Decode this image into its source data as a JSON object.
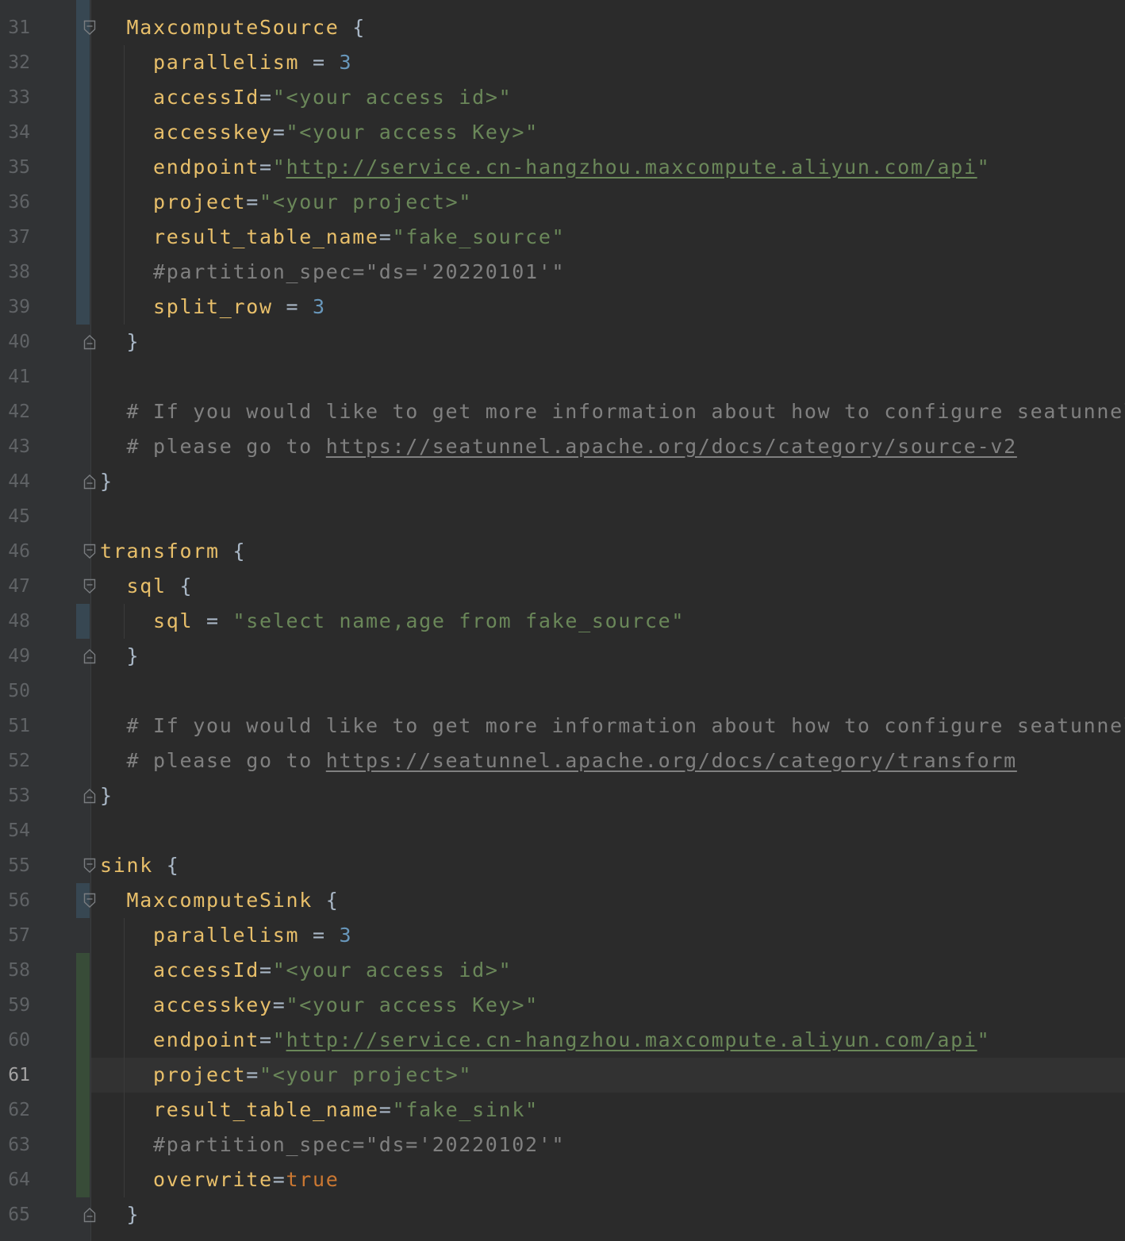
{
  "editor": {
    "active_line": "61",
    "colors": {
      "background": "#2b2b2b",
      "gutter": "#313335",
      "key": "#e8bf6a",
      "string": "#6a8759",
      "number": "#6897bb",
      "comment": "#808080",
      "boolean": "#cc7832",
      "modified_marker": "#374752",
      "added_marker": "#384c38"
    },
    "lines": [
      {
        "number": "31",
        "tokens": [
          {
            "t": "  ",
            "c": "p"
          },
          {
            "t": "MaxcomputeSource",
            "c": "k"
          },
          {
            "t": " {",
            "c": "p"
          }
        ]
      },
      {
        "number": "32",
        "tokens": [
          {
            "t": "    ",
            "c": "p"
          },
          {
            "t": "parallelism",
            "c": "k"
          },
          {
            "t": " = ",
            "c": "p"
          },
          {
            "t": "3",
            "c": "n"
          }
        ]
      },
      {
        "number": "33",
        "tokens": [
          {
            "t": "    ",
            "c": "p"
          },
          {
            "t": "accessId",
            "c": "k"
          },
          {
            "t": "=",
            "c": "p"
          },
          {
            "t": "\"<your access id>\"",
            "c": "s"
          }
        ]
      },
      {
        "number": "34",
        "tokens": [
          {
            "t": "    ",
            "c": "p"
          },
          {
            "t": "accesskey",
            "c": "k"
          },
          {
            "t": "=",
            "c": "p"
          },
          {
            "t": "\"<your access Key>\"",
            "c": "s"
          }
        ]
      },
      {
        "number": "35",
        "tokens": [
          {
            "t": "    ",
            "c": "p"
          },
          {
            "t": "endpoint",
            "c": "k"
          },
          {
            "t": "=",
            "c": "p"
          },
          {
            "t": "\"",
            "c": "s"
          },
          {
            "t": "http://service.cn-hangzhou.maxcompute.aliyun.com/api",
            "c": "su"
          },
          {
            "t": "\"",
            "c": "s"
          }
        ]
      },
      {
        "number": "36",
        "tokens": [
          {
            "t": "    ",
            "c": "p"
          },
          {
            "t": "project",
            "c": "k"
          },
          {
            "t": "=",
            "c": "p"
          },
          {
            "t": "\"<your project>\"",
            "c": "s"
          }
        ]
      },
      {
        "number": "37",
        "tokens": [
          {
            "t": "    ",
            "c": "p"
          },
          {
            "t": "result_table_name",
            "c": "k"
          },
          {
            "t": "=",
            "c": "p"
          },
          {
            "t": "\"fake_source\"",
            "c": "s"
          }
        ]
      },
      {
        "number": "38",
        "tokens": [
          {
            "t": "    ",
            "c": "p"
          },
          {
            "t": "#partition_spec=\"ds='20220101'\"",
            "c": "c"
          }
        ]
      },
      {
        "number": "39",
        "tokens": [
          {
            "t": "    ",
            "c": "p"
          },
          {
            "t": "split_row",
            "c": "k"
          },
          {
            "t": " = ",
            "c": "p"
          },
          {
            "t": "3",
            "c": "n"
          }
        ]
      },
      {
        "number": "40",
        "tokens": [
          {
            "t": "  }",
            "c": "p"
          }
        ]
      },
      {
        "number": "41",
        "tokens": []
      },
      {
        "number": "42",
        "tokens": [
          {
            "t": "  # If you would like to get more information about how to configure seatunnel and see full list of source plugins,",
            "c": "c"
          }
        ]
      },
      {
        "number": "43",
        "tokens": [
          {
            "t": "  # please go to ",
            "c": "c"
          },
          {
            "t": "https://seatunnel.apache.org/docs/category/source-v2",
            "c": "cu"
          }
        ]
      },
      {
        "number": "44",
        "tokens": [
          {
            "t": "}",
            "c": "p"
          }
        ]
      },
      {
        "number": "45",
        "tokens": []
      },
      {
        "number": "46",
        "tokens": [
          {
            "t": "transform",
            "c": "k"
          },
          {
            "t": " {",
            "c": "p"
          }
        ]
      },
      {
        "number": "47",
        "tokens": [
          {
            "t": "  ",
            "c": "p"
          },
          {
            "t": "sql",
            "c": "k"
          },
          {
            "t": " {",
            "c": "p"
          }
        ]
      },
      {
        "number": "48",
        "tokens": [
          {
            "t": "    ",
            "c": "p"
          },
          {
            "t": "sql",
            "c": "k"
          },
          {
            "t": " = ",
            "c": "p"
          },
          {
            "t": "\"select name,age from fake_source\"",
            "c": "s"
          }
        ]
      },
      {
        "number": "49",
        "tokens": [
          {
            "t": "  }",
            "c": "p"
          }
        ]
      },
      {
        "number": "50",
        "tokens": []
      },
      {
        "number": "51",
        "tokens": [
          {
            "t": "  # If you would like to get more information about how to configure seatunnel and see full list of transform plugins,",
            "c": "c"
          }
        ]
      },
      {
        "number": "52",
        "tokens": [
          {
            "t": "  # please go to ",
            "c": "c"
          },
          {
            "t": "https://seatunnel.apache.org/docs/category/transform",
            "c": "cu"
          }
        ]
      },
      {
        "number": "53",
        "tokens": [
          {
            "t": "}",
            "c": "p"
          }
        ]
      },
      {
        "number": "54",
        "tokens": []
      },
      {
        "number": "55",
        "tokens": [
          {
            "t": "sink",
            "c": "k"
          },
          {
            "t": " {",
            "c": "p"
          }
        ]
      },
      {
        "number": "56",
        "tokens": [
          {
            "t": "  ",
            "c": "p"
          },
          {
            "t": "MaxcomputeSink",
            "c": "k"
          },
          {
            "t": " {",
            "c": "p"
          }
        ]
      },
      {
        "number": "57",
        "tokens": [
          {
            "t": "    ",
            "c": "p"
          },
          {
            "t": "parallelism",
            "c": "k"
          },
          {
            "t": " = ",
            "c": "p"
          },
          {
            "t": "3",
            "c": "n"
          }
        ]
      },
      {
        "number": "58",
        "tokens": [
          {
            "t": "    ",
            "c": "p"
          },
          {
            "t": "accessId",
            "c": "k"
          },
          {
            "t": "=",
            "c": "p"
          },
          {
            "t": "\"<your access id>\"",
            "c": "s"
          }
        ]
      },
      {
        "number": "59",
        "tokens": [
          {
            "t": "    ",
            "c": "p"
          },
          {
            "t": "accesskey",
            "c": "k"
          },
          {
            "t": "=",
            "c": "p"
          },
          {
            "t": "\"<your access Key>\"",
            "c": "s"
          }
        ]
      },
      {
        "number": "60",
        "tokens": [
          {
            "t": "    ",
            "c": "p"
          },
          {
            "t": "endpoint",
            "c": "k"
          },
          {
            "t": "=",
            "c": "p"
          },
          {
            "t": "\"",
            "c": "s"
          },
          {
            "t": "http://service.cn-hangzhou.maxcompute.aliyun.com/api",
            "c": "su"
          },
          {
            "t": "\"",
            "c": "s"
          }
        ]
      },
      {
        "number": "61",
        "tokens": [
          {
            "t": "    ",
            "c": "p"
          },
          {
            "t": "project",
            "c": "k"
          },
          {
            "t": "=",
            "c": "p"
          },
          {
            "t": "\"<your project>\"",
            "c": "s"
          }
        ]
      },
      {
        "number": "62",
        "tokens": [
          {
            "t": "    ",
            "c": "p"
          },
          {
            "t": "result_table_name",
            "c": "k"
          },
          {
            "t": "=",
            "c": "p"
          },
          {
            "t": "\"fake_sink\"",
            "c": "s"
          }
        ]
      },
      {
        "number": "63",
        "tokens": [
          {
            "t": "    ",
            "c": "p"
          },
          {
            "t": "#partition_spec=\"ds='20220102'\"",
            "c": "c"
          }
        ]
      },
      {
        "number": "64",
        "tokens": [
          {
            "t": "    ",
            "c": "p"
          },
          {
            "t": "overwrite",
            "c": "k"
          },
          {
            "t": "=",
            "c": "p"
          },
          {
            "t": "true",
            "c": "b"
          }
        ]
      },
      {
        "number": "65",
        "tokens": [
          {
            "t": "  }",
            "c": "p"
          }
        ]
      }
    ]
  }
}
